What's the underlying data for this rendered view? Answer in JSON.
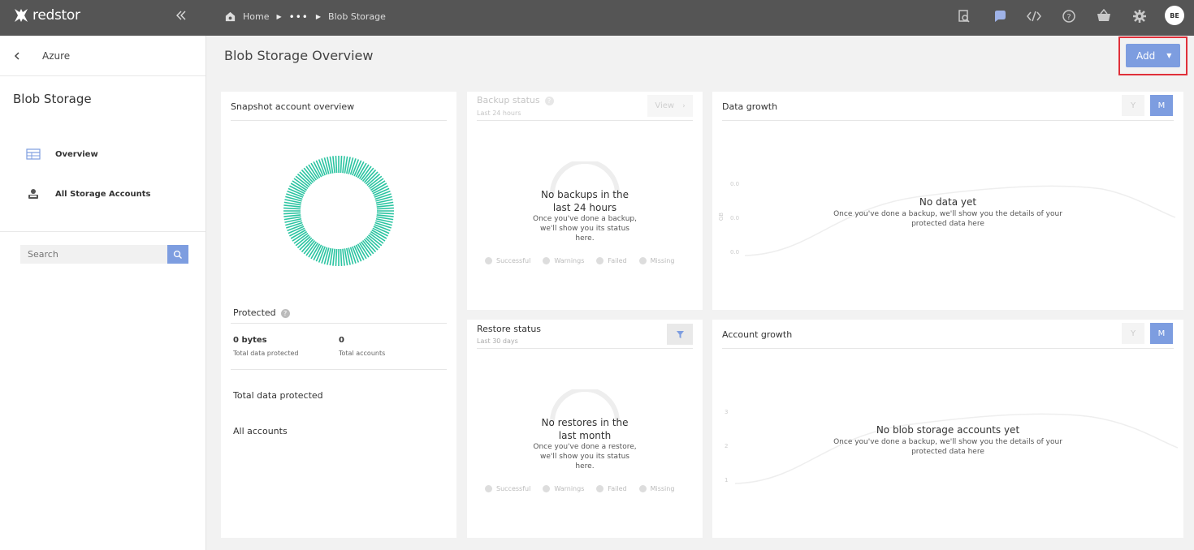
{
  "app": {
    "logo_text": "redstor",
    "user_initials": "BE"
  },
  "breadcrumb": {
    "home": "Home",
    "ellipsis": "•••",
    "current": "Blob Storage"
  },
  "topbar_icons": [
    "search-doc-icon",
    "chat-icon",
    "code-icon",
    "help-icon",
    "basket-icon",
    "gear-icon"
  ],
  "sidebar": {
    "back_label": "Azure",
    "title": "Blob Storage",
    "items": [
      {
        "label": "Overview",
        "icon": "table-icon"
      },
      {
        "label": "All Storage Accounts",
        "icon": "user-icon"
      }
    ],
    "search_placeholder": "Search"
  },
  "main": {
    "title": "Blob Storage Overview",
    "add_label": "Add"
  },
  "snapshot": {
    "title": "Snapshot account overview",
    "protected_label": "Protected",
    "bytes_value": "0 bytes",
    "bytes_label": "Total data protected",
    "accounts_value": "0",
    "accounts_label": "Total accounts",
    "total_data_label": "Total data protected",
    "all_accounts_label": "All accounts"
  },
  "backup": {
    "title": "Backup status",
    "subtitle": "Last 24 hours",
    "view_label": "View",
    "empty_title": "No backups in the last 24 hours",
    "empty_sub": "Once you've done a backup, we'll show you its status here.",
    "legend": [
      "Successful",
      "Warnings",
      "Failed",
      "Missing"
    ]
  },
  "restore": {
    "title": "Restore status",
    "subtitle": "Last 30 days",
    "empty_title": "No restores in the last month",
    "empty_sub": "Once you've done a restore, we'll show you its status here.",
    "legend": [
      "Successful",
      "Warnings",
      "Failed",
      "Missing"
    ]
  },
  "data_growth": {
    "title": "Data growth",
    "y_label": "Y",
    "m_label": "M",
    "empty_title": "No data yet",
    "empty_sub": "Once you've done a backup, we'll show you the details of your protected data here",
    "axis_unit": "GB",
    "ticks": [
      "0.0",
      "0.0",
      "0.0"
    ]
  },
  "account_growth": {
    "title": "Account growth",
    "y_label": "Y",
    "m_label": "M",
    "empty_title": "No blob storage accounts yet",
    "empty_sub": "Once you've done a backup, we'll show you the details of your protected data here",
    "ticks": [
      "3",
      "2",
      "1"
    ]
  },
  "colors": {
    "accent": "#7d9de0",
    "donut": "#2bc4a1",
    "topbar": "#555555",
    "highlight": "#e0303a"
  }
}
